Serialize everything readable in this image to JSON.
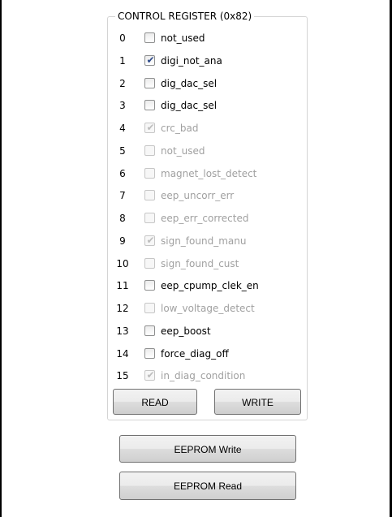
{
  "control_register": {
    "title": "CONTROL REGISTER (0x82)",
    "bits": [
      {
        "index": "0",
        "label": "not_used",
        "checked": false,
        "enabled": true
      },
      {
        "index": "1",
        "label": "digi_not_ana",
        "checked": true,
        "enabled": true
      },
      {
        "index": "2",
        "label": "dig_dac_sel",
        "checked": false,
        "enabled": true
      },
      {
        "index": "3",
        "label": "dig_dac_sel",
        "checked": false,
        "enabled": true
      },
      {
        "index": "4",
        "label": "crc_bad",
        "checked": true,
        "enabled": false
      },
      {
        "index": "5",
        "label": "not_used",
        "checked": false,
        "enabled": false
      },
      {
        "index": "6",
        "label": "magnet_lost_detect",
        "checked": false,
        "enabled": false
      },
      {
        "index": "7",
        "label": "eep_uncorr_err",
        "checked": false,
        "enabled": false
      },
      {
        "index": "8",
        "label": "eep_err_corrected",
        "checked": false,
        "enabled": false
      },
      {
        "index": "9",
        "label": "sign_found_manu",
        "checked": true,
        "enabled": false
      },
      {
        "index": "10",
        "label": "sign_found_cust",
        "checked": false,
        "enabled": false
      },
      {
        "index": "11",
        "label": "eep_cpump_clek_en",
        "checked": false,
        "enabled": true
      },
      {
        "index": "12",
        "label": "low_voltage_detect",
        "checked": false,
        "enabled": false
      },
      {
        "index": "13",
        "label": "eep_boost",
        "checked": false,
        "enabled": true
      },
      {
        "index": "14",
        "label": "force_diag_off",
        "checked": false,
        "enabled": true
      },
      {
        "index": "15",
        "label": "in_diag_condition",
        "checked": true,
        "enabled": false
      }
    ],
    "read_label": "READ",
    "write_label": "WRITE"
  },
  "eeprom": {
    "write_label": "EEPROM Write",
    "read_label": "EEPROM Read"
  },
  "colors": {
    "check_mark": "#2d4a8a",
    "disabled_text": "#a0a0a0",
    "group_border": "#d4d4d4"
  }
}
